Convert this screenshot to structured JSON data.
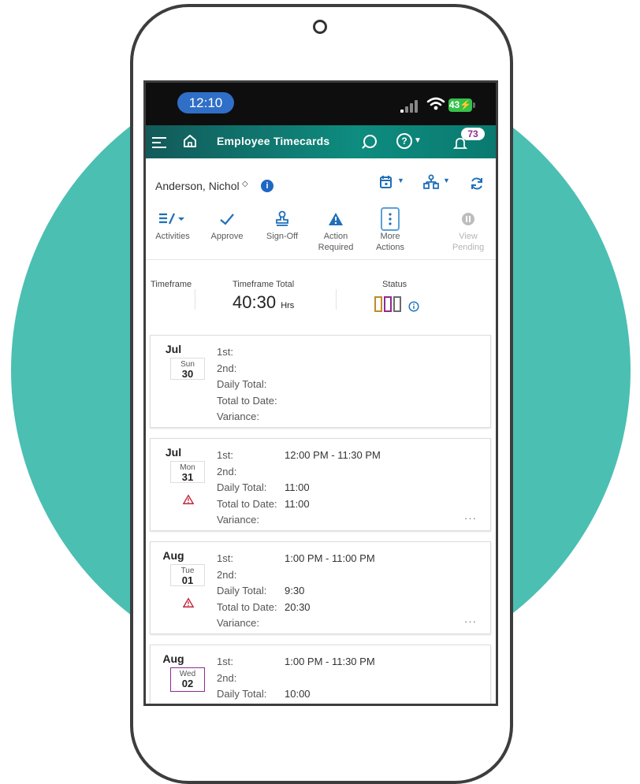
{
  "status_bar": {
    "time": "12:10",
    "battery": "43"
  },
  "app_bar": {
    "title": "Employee Timecards",
    "notification_count": "73"
  },
  "employee": {
    "name": "Anderson, Nichol"
  },
  "actions": [
    {
      "label": "Activities",
      "label2": ""
    },
    {
      "label": "Approve",
      "label2": ""
    },
    {
      "label": "Sign-Off",
      "label2": ""
    },
    {
      "label": "Action",
      "label2": "Required"
    },
    {
      "label": "More",
      "label2": "Actions"
    },
    {
      "label": "View",
      "label2": "Pending"
    }
  ],
  "summary": {
    "timeframe_label": "Timeframe",
    "total_label": "Timeframe Total",
    "total_value": "40:30",
    "total_unit": "Hrs",
    "status_label": "Status",
    "status_colors": [
      "#c08a2a",
      "#8e2b8f",
      "#6b6b6b"
    ]
  },
  "row_labels": {
    "first": "1st:",
    "second": "2nd:",
    "daily": "Daily Total:",
    "to_date": "Total to Date:",
    "variance": "Variance:"
  },
  "days": [
    {
      "month": "Jul",
      "dow": "Sun",
      "day": "30",
      "first": "",
      "second": "",
      "daily": "",
      "to_date": "",
      "variance": "",
      "warning": false
    },
    {
      "month": "Jul",
      "dow": "Mon",
      "day": "31",
      "first": "12:00 PM  -  11:30 PM",
      "second": "",
      "daily": "11:00",
      "to_date": "11:00",
      "variance": "",
      "warning": true
    },
    {
      "month": "Aug",
      "dow": "Tue",
      "day": "01",
      "first": "1:00 PM  -  11:00 PM",
      "second": "",
      "daily": "9:30",
      "to_date": "20:30",
      "variance": "",
      "warning": true
    },
    {
      "month": "Aug",
      "dow": "Wed",
      "day": "02",
      "first": "1:00 PM  -  11:30 PM",
      "second": "",
      "daily": "10:00",
      "to_date": "",
      "variance": "",
      "warning": false
    }
  ],
  "more_glyph": "···"
}
